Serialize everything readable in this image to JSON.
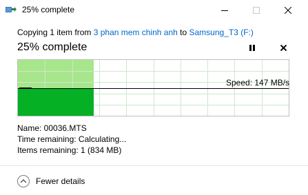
{
  "window": {
    "title": "25% complete",
    "app_icon": "copy-arrow-icon",
    "controls": [
      "minimize-icon",
      "maximize-icon",
      "close-icon"
    ]
  },
  "copy": {
    "prefix": "Copying 1 item from ",
    "source": "3 phan mem chinh anh",
    "middle": " to ",
    "destination": "Samsung_T3 (F:)"
  },
  "progress": {
    "title": "25% complete",
    "percent": 25,
    "pause_icon": "pause-icon",
    "cancel_icon": "close-icon",
    "speed_label": "Speed: 147 MB/s"
  },
  "details": {
    "name": "Name:  00036.MTS",
    "time_remaining": "Time remaining:  Calculating...",
    "items_remaining": "Items remaining:  1 (834 MB)"
  },
  "footer": {
    "fewer_details": "Fewer details",
    "icon": "chevron-up-icon"
  },
  "colors": {
    "progress_fill": "#a8e68c",
    "speed_fill": "#06b025",
    "link": "#0066cc",
    "grid": "#cde8cd"
  }
}
